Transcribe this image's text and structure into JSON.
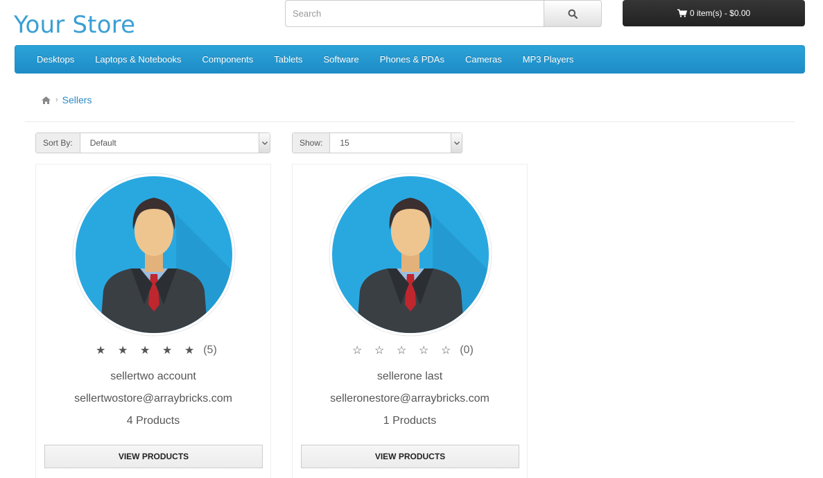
{
  "header": {
    "logo": "Your Store",
    "search_placeholder": "Search",
    "search_icon": "search-icon",
    "cart_label": "0 item(s) - $0.00",
    "cart_icon": "shopping-cart-icon"
  },
  "menu": {
    "items": [
      "Desktops",
      "Laptops & Notebooks",
      "Components",
      "Tablets",
      "Software",
      "Phones & PDAs",
      "Cameras",
      "MP3 Players"
    ]
  },
  "breadcrumb": {
    "home_icon": "home-icon",
    "current": "Sellers"
  },
  "controls": {
    "sort_label": "Sort By:",
    "sort_value": "Default",
    "show_label": "Show:",
    "show_value": "15"
  },
  "sellers": [
    {
      "rating": 5,
      "rating_count": "(5)",
      "name": "sellertwo account",
      "email": "sellertwostore@arraybricks.com",
      "products": "4 Products",
      "button": "VIEW PRODUCTS"
    },
    {
      "rating": 0,
      "rating_count": "(0)",
      "name": "sellerone last",
      "email": "selleronestore@arraybricks.com",
      "products": "1 Products",
      "button": "VIEW PRODUCTS"
    }
  ],
  "colors": {
    "brand": "#3a9fd4",
    "menu_bg": "#2299d2",
    "avatar_bg": "#29a8e0",
    "cart_bg": "#2a2a2a"
  }
}
